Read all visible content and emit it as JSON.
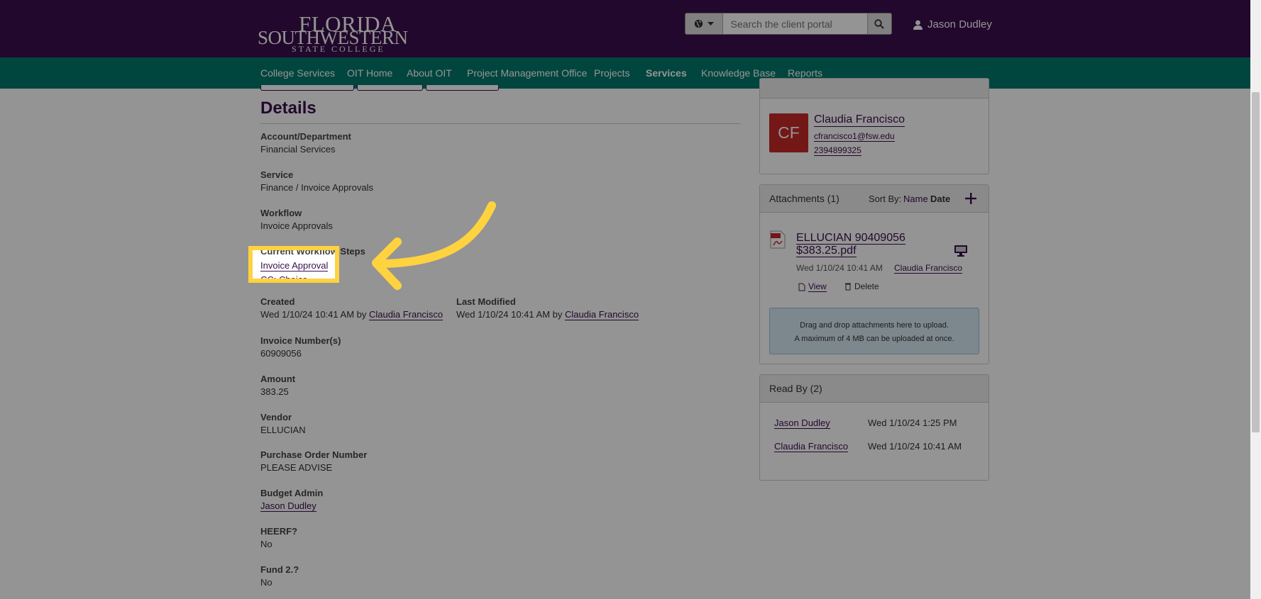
{
  "header": {
    "logo": {
      "line1": "FLORIDA",
      "line2": "SOUTHWESTERN",
      "line3": "STATE COLLEGE"
    },
    "search": {
      "scope_icon": "globe-icon",
      "placeholder": "Search the client portal",
      "button_icon": "search-icon"
    },
    "user": {
      "icon": "user-icon",
      "name": "Jason Dudley"
    }
  },
  "nav": {
    "items": [
      {
        "label": "College Services",
        "active": false
      },
      {
        "label": "OIT Home",
        "active": false
      },
      {
        "label": "About OIT",
        "active": false
      },
      {
        "label": "Project Management Office",
        "active": false
      },
      {
        "label": "Projects",
        "active": false
      },
      {
        "label": "Services",
        "active": true
      },
      {
        "label": "Knowledge Base",
        "active": false
      },
      {
        "label": "Reports",
        "active": false
      }
    ]
  },
  "details": {
    "title": "Details",
    "account": {
      "label": "Account/Department",
      "value": "Financial Services"
    },
    "service": {
      "label": "Service",
      "value": "Finance / Invoice Approvals"
    },
    "workflow": {
      "label": "Workflow",
      "value": "Invoice Approvals"
    },
    "current_steps": {
      "label": "Current Workflow Steps",
      "step1": "Invoice Approval",
      "step2": "CC: Choice"
    },
    "created": {
      "label": "Created",
      "date": "Wed 1/10/24 10:41 AM by",
      "by": "Claudia Francisco"
    },
    "modified": {
      "label": "Last Modified",
      "date": "Wed 1/10/24 10:41 AM by",
      "by": "Claudia Francisco"
    },
    "invoice_numbers": {
      "label": "Invoice Number(s)",
      "value": "60909056"
    },
    "amount": {
      "label": "Amount",
      "value": "383.25"
    },
    "vendor": {
      "label": "Vendor",
      "value": "ELLUCIAN"
    },
    "po_number": {
      "label": "Purchase Order Number",
      "value": "PLEASE ADVISE"
    },
    "budget_admin": {
      "label": "Budget Admin",
      "value": "Jason Dudley"
    },
    "heerf": {
      "label": "HEERF?",
      "value": "No"
    },
    "fund2": {
      "label": "Fund 2.?",
      "value": "No"
    }
  },
  "requestor": {
    "initials": "CF",
    "avatar_color": "#c62828",
    "name": "Claudia Francisco",
    "email": "cfrancisco1@fsw.edu",
    "phone": "2394899325"
  },
  "attachments": {
    "title": "Attachments (1)",
    "sort_label": "Sort By:",
    "sort_name": "Name",
    "sort_date": "Date",
    "add_icon": "plus-icon",
    "file": {
      "icon": "pdf-icon",
      "name_line1": "ELLUCIAN 90409056",
      "name_line2": "$383.25.pdf",
      "date": "Wed 1/10/24 10:41 AM",
      "by": "Claudia Francisco",
      "view": "View",
      "delete": "Delete"
    },
    "drop_line1": "Drag and drop attachments here to upload.",
    "drop_line2": "A maximum of 4 MB can be uploaded at once."
  },
  "read_by": {
    "title": "Read By (2)",
    "rows": [
      {
        "name": "Jason Dudley",
        "date": "Wed 1/10/24 1:25 PM"
      },
      {
        "name": "Claudia Francisco",
        "date": "Wed 1/10/24 10:41 AM"
      }
    ]
  },
  "colors": {
    "header_bg": "#3b0f4f",
    "nav_bg": "#00796b",
    "highlight": "#ffd23f",
    "link": "#3b0f4f"
  }
}
